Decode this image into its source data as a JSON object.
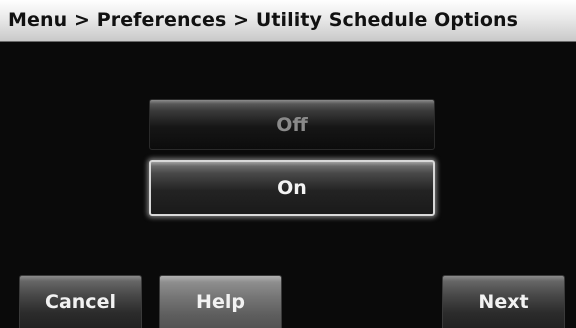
{
  "header": {
    "breadcrumb": "Menu > Preferences > Utility Schedule Options"
  },
  "options": [
    {
      "label": "Off",
      "selected": false
    },
    {
      "label": "On",
      "selected": true
    }
  ],
  "footer": {
    "cancel_label": "Cancel",
    "help_label": "Help",
    "next_label": "Next"
  }
}
